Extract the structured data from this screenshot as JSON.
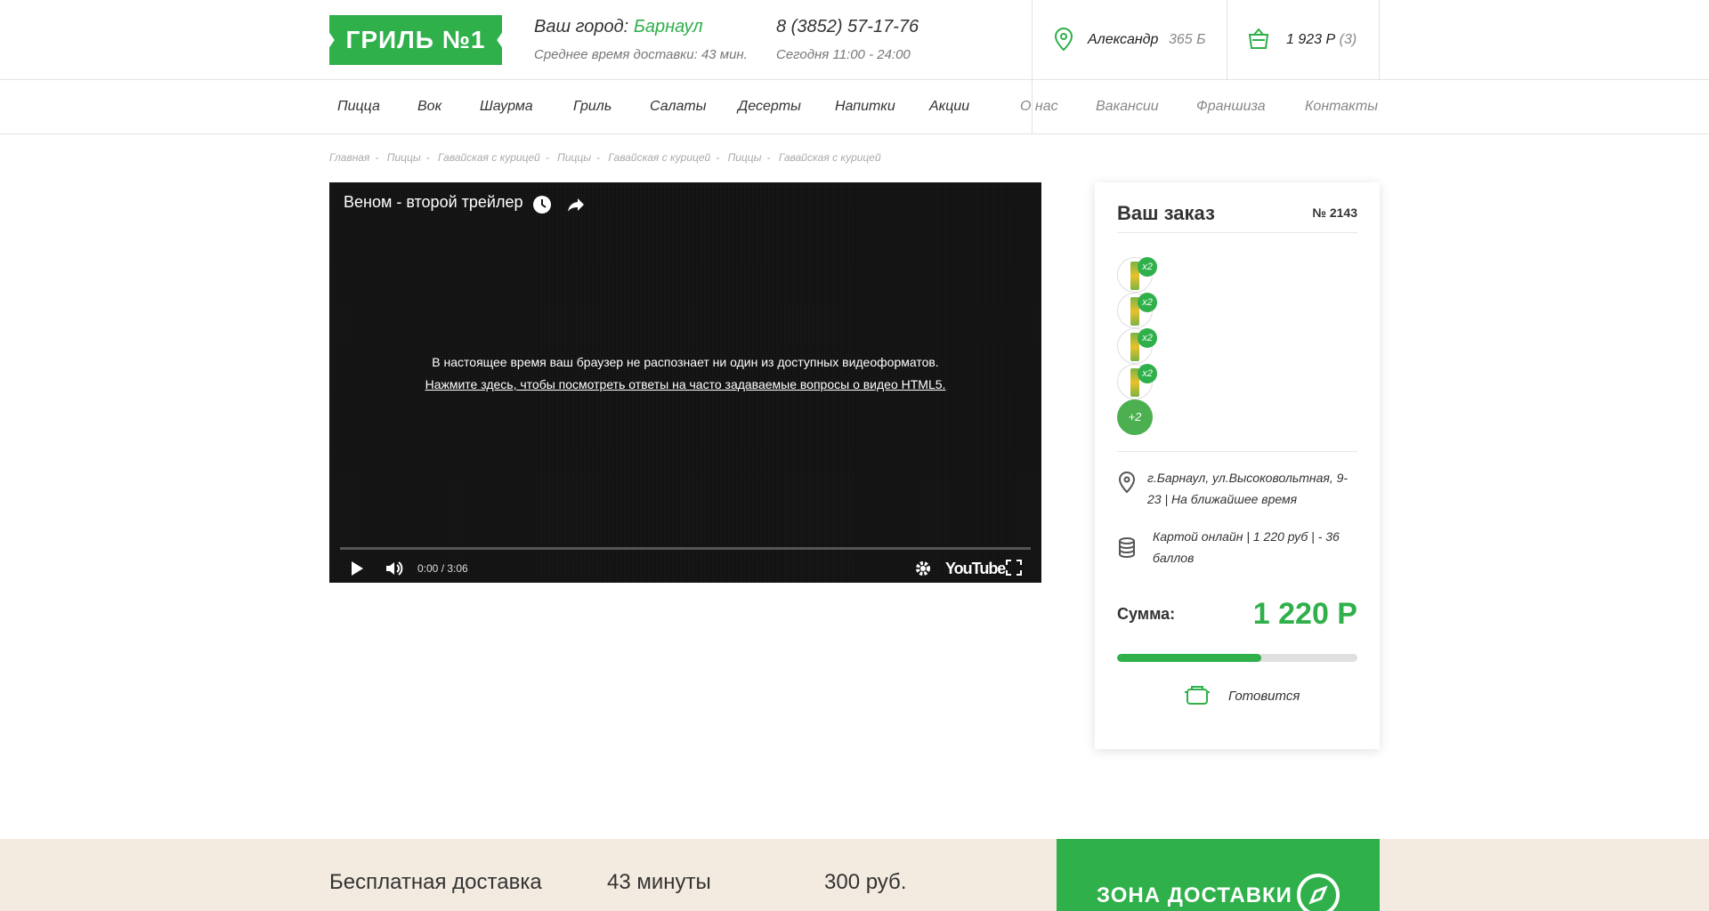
{
  "header": {
    "logo": "ГРИЛЬ №1",
    "city_label": "Ваш город:",
    "city_value": "Барнаул",
    "delivery_time": "Среднее время доставки: 43 мин.",
    "phone": "8 (3852) 57-17-76",
    "hours": "Сегодня 11:00 - 24:00",
    "user_name": "Александр",
    "user_points": "365 Б",
    "cart_total": "1 923 Р",
    "cart_count": "(3)",
    "accent_color": "#2fb04a"
  },
  "nav": {
    "main": [
      "Пицца",
      "Вок",
      "Шаурма",
      "Гриль",
      "Салаты",
      "Десерты",
      "Напитки",
      "Акции"
    ],
    "secondary": [
      "О нас",
      "Вакансии",
      "Франшиза",
      "Контакты"
    ]
  },
  "breadcrumbs": [
    "Главная",
    "Пиццы",
    "Гавайская с курицей",
    "Пиццы",
    "Гавайская с курицей",
    "Пиццы",
    "Гавайская с курицей"
  ],
  "video": {
    "title": "Веном - второй трейлер",
    "message": "В настоящее время ваш браузер не распознает ни один из доступных видеоформатов.",
    "link": "Нажмите здесь, чтобы посмотреть ответы на часто задаваемые вопросы о видео HTML5.",
    "time": "0:00 / 3:06",
    "brand": "YouTube"
  },
  "order": {
    "title": "Ваш заказ",
    "number": "№ 2143",
    "items": [
      {
        "qty": "x2",
        "icon": "drink-can-icon"
      },
      {
        "qty": "x2",
        "icon": "drink-can-icon"
      },
      {
        "qty": "x2",
        "icon": "drink-can-icon"
      },
      {
        "qty": "x2",
        "icon": "drink-can-icon"
      }
    ],
    "more": "+2",
    "address": "г.Барнаул, ул.Высоковольтная, 9-23 | На ближайшее время",
    "payment": "Картой онлайн | 1 220 руб | - 36 баллов",
    "sum_label": "Сумма:",
    "sum_value": "1 220 Р",
    "progress": 0.6,
    "status": "Готовится"
  },
  "footer_band": {
    "items": [
      {
        "title": "Бесплатная доставка"
      },
      {
        "title": "43 минуты"
      },
      {
        "title": "300 руб."
      }
    ],
    "zone_label": "ЗОНА ДОСТАВКИ"
  }
}
